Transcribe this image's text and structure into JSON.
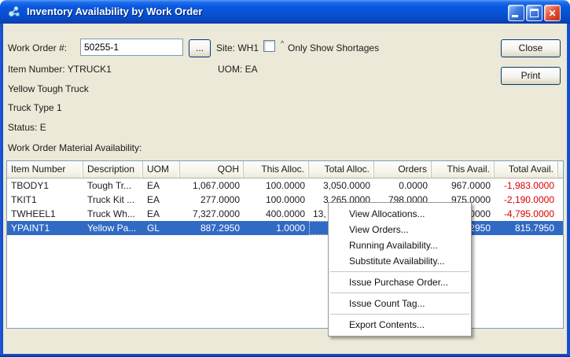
{
  "window": {
    "title": "Inventory Availability by Work Order"
  },
  "titlebar": {
    "icons": [
      "app-icon",
      "minimize-icon",
      "maximize-icon",
      "close-icon"
    ]
  },
  "form": {
    "work_order_label": "Work Order #:",
    "work_order_value": "50255-1",
    "browse_button_label": "...",
    "site_label": "Site: WH1",
    "shortages_caret": "^",
    "shortages_label": "Only Show Shortages",
    "item_number_label": "Item Number: YTRUCK1",
    "uom_label": "UOM: EA",
    "item_description_line1": "Yellow Tough Truck",
    "item_description_line2": "Truck Type 1",
    "status_label": "Status: E",
    "availability_caption": "Work Order Material Availability:"
  },
  "actions": {
    "close_label": "Close",
    "print_label": "Print"
  },
  "table": {
    "columns": [
      "Item Number",
      "Description",
      "UOM",
      "QOH",
      "This Alloc.",
      "Total Alloc.",
      "Orders",
      "This Avail.",
      "Total Avail."
    ],
    "rows": [
      {
        "cells": [
          "TBODY1",
          "Tough Tr...",
          "EA",
          "1,067.0000",
          "100.0000",
          "3,050.0000",
          "0.0000",
          "967.0000",
          "-1,983.0000"
        ]
      },
      {
        "cells": [
          "TKIT1",
          "Truck Kit ...",
          "EA",
          "277.0000",
          "100.0000",
          "3,265.0000",
          "798.0000",
          "975.0000",
          "-2,190.0000"
        ]
      },
      {
        "cells": [
          "TWHEEL1",
          "Truck Wh...",
          "EA",
          "7,327.0000",
          "400.0000",
          "13,",
          "",
          "0000",
          "-4,795.0000"
        ],
        "occluded_by_menu_cells": [
          5,
          6,
          7
        ],
        "left_align_cells": [
          5
        ]
      },
      {
        "cells": [
          "YPAINT1",
          "Yellow Pa...",
          "GL",
          "887.2950",
          "1.0000",
          "",
          "",
          "2950",
          "815.7950"
        ],
        "selected": true,
        "focus_cell": 5,
        "occluded_by_menu_cells": [
          5,
          6
        ]
      }
    ]
  },
  "context_menu": {
    "items": [
      {
        "label": "View Allocations..."
      },
      {
        "label": "View Orders..."
      },
      {
        "label": "Running Availability..."
      },
      {
        "label": "Substitute Availability..."
      },
      {
        "separator": true
      },
      {
        "label": "Issue Purchase Order..."
      },
      {
        "separator": true
      },
      {
        "label": "Issue Count Tag..."
      },
      {
        "separator": true
      },
      {
        "label": "Export Contents..."
      }
    ]
  },
  "colors": {
    "selection_blue": "#316AC5",
    "negative_red": "#DD0000",
    "dialog_bg": "#ECE9D8",
    "titlebar_blue": "#0A58DF"
  }
}
